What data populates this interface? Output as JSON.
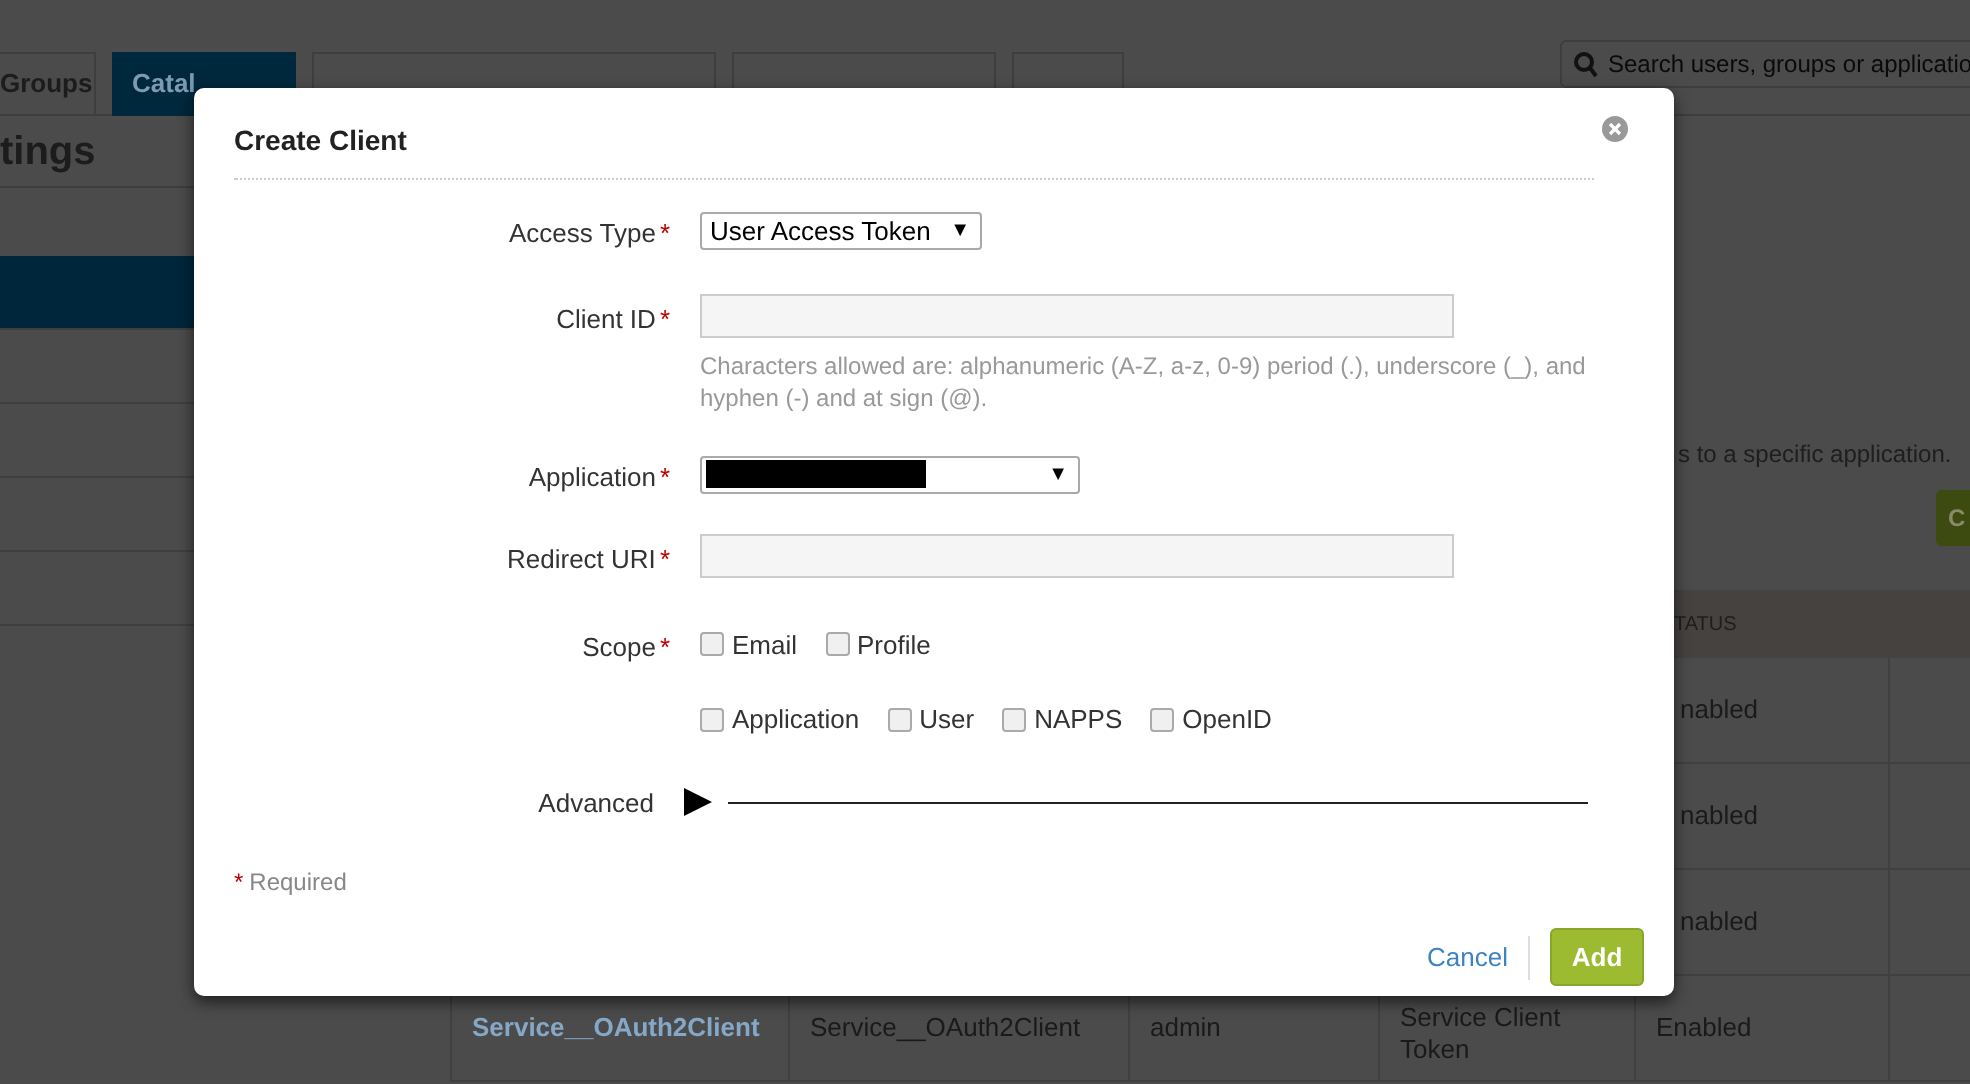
{
  "page": {
    "tabs": [
      {
        "label": "Groups",
        "selected": false
      },
      {
        "label": "Catal",
        "selected": true
      }
    ],
    "search": {
      "placeholder": "Search users, groups or applicatio"
    },
    "heading": "tings",
    "sidebar_items": [
      {
        "selected": true
      },
      {
        "selected": false
      },
      {
        "selected": false
      },
      {
        "selected": false
      },
      {
        "selected": false
      }
    ],
    "description": "s to a specific application.",
    "button": {
      "label": "C"
    },
    "table": {
      "status_header": "TATUS",
      "rows": [
        {
          "status": "nabled"
        },
        {
          "status": "nabled"
        },
        {
          "status": "nabled"
        },
        {
          "name": "Service__OAuth2Client",
          "column_2": "Service__OAuth2Client",
          "column_3": "admin",
          "column_4": "Service Client Token",
          "status": "Enabled"
        }
      ]
    }
  },
  "dialog": {
    "title": "Create Client",
    "required_mark": "*",
    "fields": [
      {
        "kind": "select",
        "label": "Access Type",
        "required": true,
        "value": "User Access Token",
        "arrow": "▼"
      },
      {
        "kind": "text",
        "label": "Client ID",
        "required": true,
        "help": "Characters allowed are: alphanumeric (A-Z, a-z, 0-9) period (.), underscore (_), and hyphen (-) and at sign (@)."
      },
      {
        "kind": "select",
        "label": "Application",
        "required": true,
        "redacted": true,
        "arrow": "▼"
      },
      {
        "kind": "text",
        "label": "Redirect URI",
        "required": true
      },
      {
        "kind": "checkboxes",
        "label": "Scope",
        "required": true,
        "rows": [
          [
            {
              "label": "Email",
              "checked": false
            },
            {
              "label": "Profile",
              "checked": false
            }
          ],
          [
            {
              "label": "Application",
              "checked": false
            },
            {
              "label": "User",
              "checked": false
            },
            {
              "label": "NAPPS",
              "checked": false
            },
            {
              "label": "OpenID",
              "checked": false
            }
          ]
        ]
      }
    ],
    "advanced": {
      "label": "Advanced",
      "expanded": false
    },
    "required_note": "Required",
    "buttons": {
      "cancel": "Cancel",
      "add": "Add"
    }
  }
}
